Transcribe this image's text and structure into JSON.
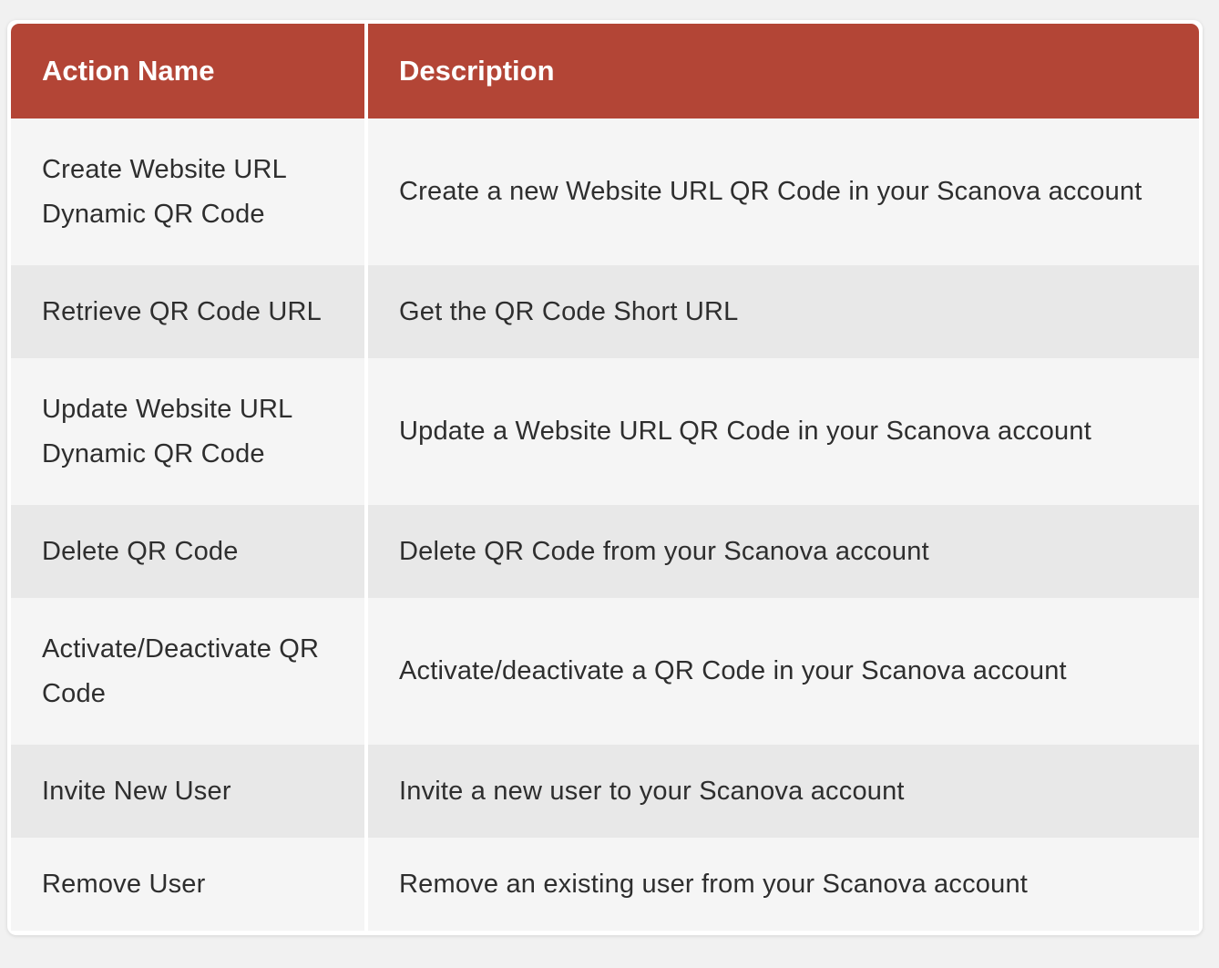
{
  "table": {
    "header": {
      "action_name": "Action Name",
      "description": "Description"
    },
    "rows": [
      {
        "action": "Create Website URL Dynamic QR Code",
        "description": "Create a new Website URL QR Code in your Scanova account"
      },
      {
        "action": "Retrieve QR Code URL",
        "description": "Get the QR Code Short URL"
      },
      {
        "action": "Update Website URL Dynamic QR Code",
        "description": "Update a Website URL QR Code in your Scanova account"
      },
      {
        "action": "Delete QR Code",
        "description": "Delete QR Code from your Scanova account"
      },
      {
        "action": "Activate/Deactivate QR Code",
        "description": "Activate/deactivate a QR Code in your Scanova account"
      },
      {
        "action": "Invite New User",
        "description": "Invite a new user to your Scanova account"
      },
      {
        "action": "Remove User",
        "description": "Remove an existing user from your Scanova account"
      }
    ]
  },
  "colors": {
    "header_bg": "#b34536",
    "header_text": "#ffffff",
    "row_light": "#f5f5f5",
    "row_dark": "#e8e8e8",
    "body_text": "#2e2e2e"
  }
}
